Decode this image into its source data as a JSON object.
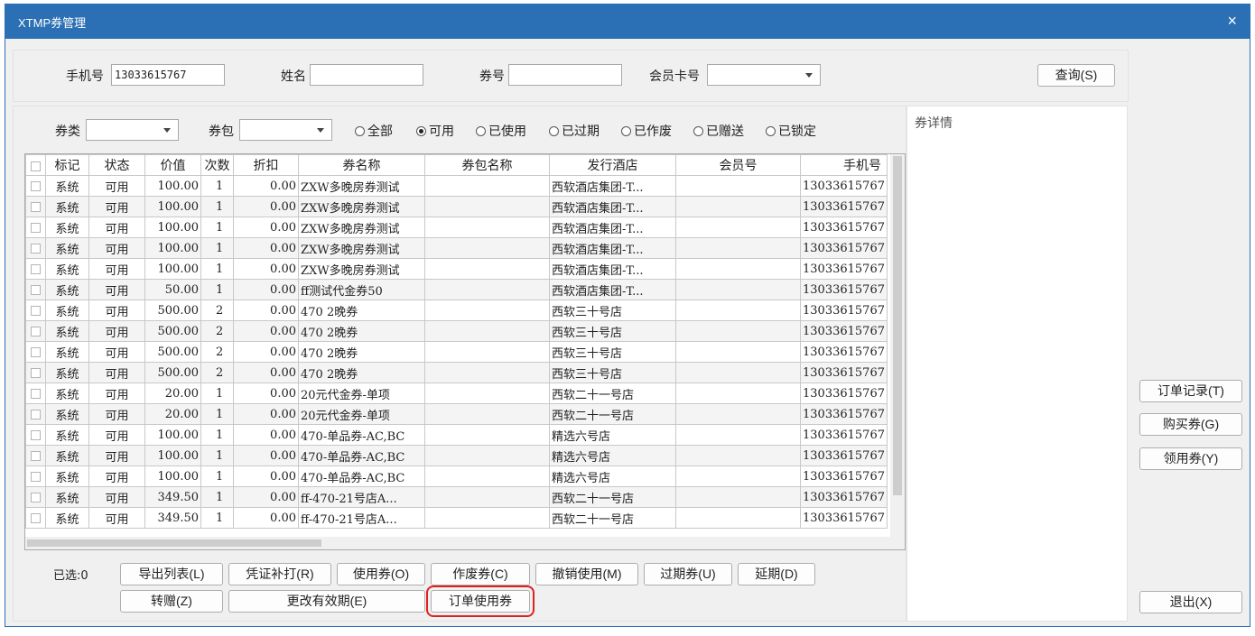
{
  "window": {
    "title": "XTMP券管理",
    "close": "×"
  },
  "search": {
    "phone_label": "手机号",
    "phone_value": "13033615767",
    "name_label": "姓名",
    "name_value": "",
    "coupon_no_label": "券号",
    "coupon_no_value": "",
    "member_card_label": "会员卡号",
    "member_card_value": "",
    "query_button": "查询(S)"
  },
  "filters": {
    "type_label": "券类",
    "type_value": "",
    "pack_label": "券包",
    "pack_value": "",
    "status_options": [
      "全部",
      "可用",
      "已使用",
      "已过期",
      "已作废",
      "已赠送",
      "已锁定"
    ],
    "selected_status": "可用"
  },
  "table": {
    "columns": [
      "",
      "标记",
      "状态",
      "价值",
      "次数",
      "折扣",
      "券名称",
      "券包名称",
      "发行酒店",
      "会员号",
      "手机号"
    ],
    "rows": [
      [
        "系统",
        "可用",
        "100.00",
        "1",
        "0.00",
        "ZXW多晚房券测试",
        "",
        "西软酒店集团-T...",
        "",
        "13033615767"
      ],
      [
        "系统",
        "可用",
        "100.00",
        "1",
        "0.00",
        "ZXW多晚房券测试",
        "",
        "西软酒店集团-T...",
        "",
        "13033615767"
      ],
      [
        "系统",
        "可用",
        "100.00",
        "1",
        "0.00",
        "ZXW多晚房券测试",
        "",
        "西软酒店集团-T...",
        "",
        "13033615767"
      ],
      [
        "系统",
        "可用",
        "100.00",
        "1",
        "0.00",
        "ZXW多晚房券测试",
        "",
        "西软酒店集团-T...",
        "",
        "13033615767"
      ],
      [
        "系统",
        "可用",
        "100.00",
        "1",
        "0.00",
        "ZXW多晚房券测试",
        "",
        "西软酒店集团-T...",
        "",
        "13033615767"
      ],
      [
        "系统",
        "可用",
        "50.00",
        "1",
        "0.00",
        "ff测试代金券50",
        "",
        "西软酒店集团-T...",
        "",
        "13033615767"
      ],
      [
        "系统",
        "可用",
        "500.00",
        "2",
        "0.00",
        "470  2晚券",
        "",
        "西软三十号店",
        "",
        "13033615767"
      ],
      [
        "系统",
        "可用",
        "500.00",
        "2",
        "0.00",
        "470  2晚券",
        "",
        "西软三十号店",
        "",
        "13033615767"
      ],
      [
        "系统",
        "可用",
        "500.00",
        "2",
        "0.00",
        "470  2晚券",
        "",
        "西软三十号店",
        "",
        "13033615767"
      ],
      [
        "系统",
        "可用",
        "500.00",
        "2",
        "0.00",
        "470  2晚券",
        "",
        "西软三十号店",
        "",
        "13033615767"
      ],
      [
        "系统",
        "可用",
        "20.00",
        "1",
        "0.00",
        "20元代金券-单项",
        "",
        "西软二十一号店",
        "",
        "13033615767"
      ],
      [
        "系统",
        "可用",
        "20.00",
        "1",
        "0.00",
        "20元代金券-单项",
        "",
        "西软二十一号店",
        "",
        "13033615767"
      ],
      [
        "系统",
        "可用",
        "100.00",
        "1",
        "0.00",
        "470-单品券-AC,BC",
        "",
        "精选六号店",
        "",
        "13033615767"
      ],
      [
        "系统",
        "可用",
        "100.00",
        "1",
        "0.00",
        "470-单品券-AC,BC",
        "",
        "精选六号店",
        "",
        "13033615767"
      ],
      [
        "系统",
        "可用",
        "100.00",
        "1",
        "0.00",
        "470-单品券-AC,BC",
        "",
        "精选六号店",
        "",
        "13033615767"
      ],
      [
        "系统",
        "可用",
        "349.50",
        "1",
        "0.00",
        "ff-470-21号店A...",
        "",
        "西软二十一号店",
        "",
        "13033615767"
      ],
      [
        "系统",
        "可用",
        "349.50",
        "1",
        "0.00",
        "ff-470-21号店A...",
        "",
        "西软二十一号店",
        "",
        "13033615767"
      ]
    ]
  },
  "actions": {
    "selected_label": "已选:0",
    "export": "导出列表(L)",
    "reprint": "凭证补打(R)",
    "use": "使用券(O)",
    "void": "作废券(C)",
    "undo_use": "撤销使用(M)",
    "expire": "过期券(U)",
    "extend": "延期(D)",
    "transfer": "转赠(Z)",
    "change_validity": "更改有效期(E)",
    "order_use": "订单使用券"
  },
  "detail": {
    "title": "券详情"
  },
  "side": {
    "order_record": "订单记录(T)",
    "buy": "购买券(G)",
    "claim": "领用券(Y)",
    "exit": "退出(X)"
  }
}
